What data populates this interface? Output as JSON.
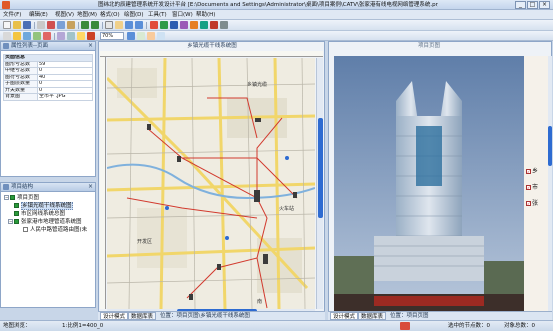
{
  "window": {
    "title": "图纬北的辰建管理系统开发设计平台 [E:\\Documents and Settings\\Administrator\\桌面\\项目案例\\CATV\\张家港有线电视网络管理系统.prj]",
    "controls": {
      "minimize": "_",
      "maximize": "□",
      "close": "×"
    }
  },
  "menu": [
    "文件(F)",
    "编辑(E)",
    "视图(V)",
    "地图(M)",
    "格式(O)",
    "绘图(D)",
    "工具(T)",
    "窗口(W)",
    "帮助(H)"
  ],
  "toolbar": {
    "zoom_value": "70%",
    "icons": [
      "new-icon",
      "open-icon",
      "save-icon",
      "print-icon",
      "cut-icon",
      "copy-icon",
      "paste-icon",
      "undo-icon",
      "redo-icon",
      "pointer-icon",
      "pan-icon",
      "zoom-in-icon",
      "zoom-out-icon"
    ]
  },
  "propPane": {
    "title": "属性列表--页面",
    "group": "页面信息",
    "rows": [
      {
        "key": "图形号总数",
        "value": "59"
      },
      {
        "key": "中继号总数",
        "value": "0"
      },
      {
        "key": "图符号总数",
        "value": "40"
      },
      {
        "key": "子图层数量",
        "value": "0"
      },
      {
        "key": "开关数量",
        "value": "0"
      },
      {
        "key": "背景图",
        "value": "全市平 .JPG"
      }
    ]
  },
  "treePane": {
    "title": "项目结构",
    "nodes": [
      {
        "label": "项目页图",
        "level": 0
      },
      {
        "label": "乡镇光缆干线系统图",
        "level": 1,
        "selected": true
      },
      {
        "label": "市区网线系统总图",
        "level": 1
      },
      {
        "label": "张家港市地理管道系统图",
        "level": 1
      },
      {
        "label": "人民中路管道路由图(未",
        "level": 2
      }
    ]
  },
  "mapWin": {
    "tab": "乡镇光缆干线系统图",
    "bottom_tabs": [
      "设计模式",
      "数据库表"
    ],
    "path": "位置：项目页图\\乡镇光缆干线系统图",
    "labels": [
      "乡镇光缆",
      "火车站",
      "开发区",
      "南"
    ]
  },
  "imgWin": {
    "tab": "项目页图",
    "bottom_tabs": [
      "设计模式",
      "数据库表"
    ],
    "path": "位置：项目页图",
    "side_items": [
      "乡",
      "市",
      "张"
    ]
  },
  "status": {
    "left": "地图浏览：",
    "mid": "1:比例1=400_0",
    "right1": "选中的节点数：0",
    "right2": "对象总数：0"
  },
  "colors": {
    "accent": "#2e6bd1",
    "route": "#d23a2e",
    "sky": "#7f9ac0"
  }
}
